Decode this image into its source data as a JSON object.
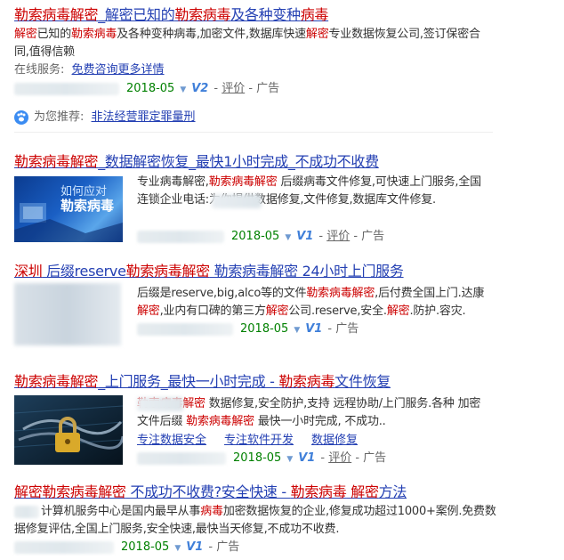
{
  "r1": {
    "title_parts": [
      {
        "t": "勒索病毒解密",
        "red": true
      },
      {
        "t": "_解密已知的",
        "red": false
      },
      {
        "t": "勒索病毒",
        "red": true
      },
      {
        "t": "及各种变种",
        "red": false
      },
      {
        "t": "病毒",
        "red": true
      }
    ],
    "desc_parts": [
      {
        "t": "解密",
        "red": true
      },
      {
        "t": "已知的",
        "red": false
      },
      {
        "t": "勒索病毒",
        "red": true
      },
      {
        "t": "及各种变种病毒,加密文件,数据库快速",
        "red": false
      },
      {
        "t": "解密",
        "red": true
      },
      {
        "t": "专业数据恢复公司,签订保密合同,值得信赖",
        "red": false
      }
    ],
    "service_label": "在线服务:",
    "service_link": "免费咨询更多详情",
    "date": "2018-05",
    "vbadge": "V2",
    "rating": "评价",
    "ad": "广告"
  },
  "recommend": {
    "label": "为您推荐:",
    "link": "非法经营罪定罪量刑"
  },
  "r2": {
    "title_parts": [
      {
        "t": "勒索病毒解密",
        "red": true
      },
      {
        "t": "_数据解密恢复_最快1小时完成_不成功不收费",
        "red": false
      }
    ],
    "img_line1": "如何应对",
    "img_line2": "勒索病毒",
    "desc_parts": [
      {
        "t": "专业病毒解密,",
        "red": false
      },
      {
        "t": "勒索病毒解密",
        "red": true
      },
      {
        "t": " 后缀病毒文件修复,可快速上门服务,全国连锁企业电话:",
        "red": false
      },
      {
        "t": "为你提供数据修复,文件修复,数据库文件修复.",
        "red": false
      }
    ],
    "date": "2018-05",
    "vbadge": "V1",
    "rating": "评价",
    "ad": "广告"
  },
  "r3": {
    "title_parts": [
      {
        "t": "深圳",
        "red": true
      },
      {
        "t": " 后缀reserve",
        "red": false
      },
      {
        "t": "勒索病毒解密",
        "red": true
      },
      {
        "t": " 勒索病毒解密 24小时上门服务",
        "red": false
      }
    ],
    "desc_parts": [
      {
        "t": "后缀是reserve,big,alco等的文件",
        "red": false
      },
      {
        "t": "勒索病毒解密",
        "red": true
      },
      {
        "t": ",后付费全国上门.达康",
        "red": false
      },
      {
        "t": "解密",
        "red": true
      },
      {
        "t": ",业内有口碑的第三方",
        "red": false
      },
      {
        "t": "解密",
        "red": true
      },
      {
        "t": "公司.reserve,安全.",
        "red": false
      },
      {
        "t": "解密",
        "red": true
      },
      {
        "t": ".防护.容灾.",
        "red": false
      }
    ],
    "date": "2018-05",
    "vbadge": "V1",
    "ad": "广告"
  },
  "r4": {
    "title_parts": [
      {
        "t": "勒索病毒解密",
        "red": true
      },
      {
        "t": "_上门服务_最快一小时完成 - ",
        "red": false
      },
      {
        "t": "勒索病毒",
        "red": true
      },
      {
        "t": "文件恢复",
        "red": false
      }
    ],
    "desc_parts": [
      {
        "t": "勒索病毒解密",
        "red": true
      },
      {
        "t": " 数据修复,安全防护,支持 远程协助/上门服务.",
        "red": false
      },
      {
        "t": "各种 加密文件后缀 ",
        "red": false
      },
      {
        "t": "勒索病毒解密",
        "red": true
      },
      {
        "t": " 最快一小时完成, 不成功..",
        "red": false
      }
    ],
    "sublinks": [
      "专注数据安全",
      "专注软件开发",
      "数据修复"
    ],
    "date": "2018-05",
    "vbadge": "V1",
    "rating": "评价",
    "ad": "广告"
  },
  "r5": {
    "title_parts": [
      {
        "t": "解密",
        "red": true
      },
      {
        "t": "勒索病毒解密",
        "red": true
      },
      {
        "t": " 不成功不收费?安全快速 - ",
        "red": false
      },
      {
        "t": "勒索病毒",
        "red": true
      },
      {
        "t": " 解密",
        "red": true
      },
      {
        "t": "方法",
        "red": false
      }
    ],
    "desc_parts": [
      {
        "t": "计算机服务中心是国内最早从事",
        "red": false
      },
      {
        "t": "病毒",
        "red": true
      },
      {
        "t": "加密数据恢复的企业,修复成功超过1000+案例.免费数据修复评估,全国上门服务,安全快速,最快当天修复,不成功不收费.",
        "red": false
      }
    ],
    "date": "2018-05",
    "vbadge": "V1",
    "ad": "广告"
  }
}
